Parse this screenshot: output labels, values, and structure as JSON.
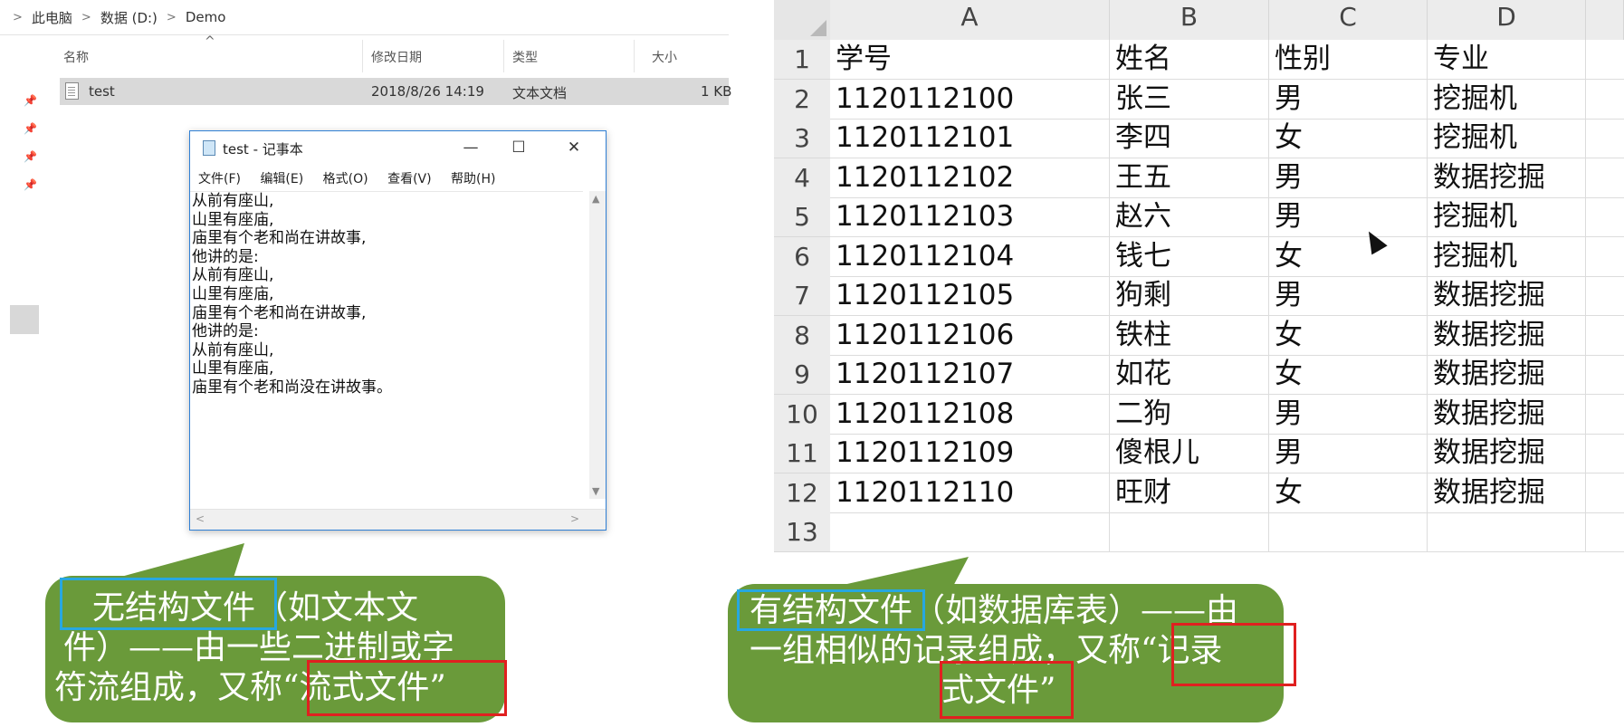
{
  "explorer": {
    "breadcrumb": [
      ">",
      "此电脑",
      ">",
      "数据 (D:)",
      ">",
      "Demo"
    ],
    "columns": {
      "name": "名称",
      "modified": "修改日期",
      "type": "类型",
      "size": "大小"
    },
    "file": {
      "name": "test",
      "modified": "2018/8/26 14:19",
      "type": "文本文档",
      "size": "1 KB"
    }
  },
  "notepad": {
    "title": "test - 记事本",
    "menu": [
      "文件(F)",
      "编辑(E)",
      "格式(O)",
      "查看(V)",
      "帮助(H)"
    ],
    "lines": [
      "从前有座山,",
      "山里有座庙,",
      "庙里有个老和尚在讲故事,",
      "他讲的是:",
      "从前有座山,",
      "山里有座庙,",
      "庙里有个老和尚在讲故事,",
      "他讲的是:",
      "从前有座山,",
      "山里有座庙,",
      "庙里有个老和尚没在讲故事。"
    ]
  },
  "sheet": {
    "columns": [
      "A",
      "B",
      "C",
      "D"
    ],
    "row_numbers": [
      "1",
      "2",
      "3",
      "4",
      "5",
      "6",
      "7",
      "8",
      "9",
      "10",
      "11",
      "12",
      "13"
    ],
    "rows": [
      [
        "学号",
        "姓名",
        "性别",
        "专业"
      ],
      [
        "1120112100",
        "张三",
        "男",
        "挖掘机"
      ],
      [
        "1120112101",
        "李四",
        "女",
        "挖掘机"
      ],
      [
        "1120112102",
        "王五",
        "男",
        "数据挖掘"
      ],
      [
        "1120112103",
        "赵六",
        "男",
        "挖掘机"
      ],
      [
        "1120112104",
        "钱七",
        "女",
        "挖掘机"
      ],
      [
        "1120112105",
        "狗剩",
        "男",
        "数据挖掘"
      ],
      [
        "1120112106",
        "铁柱",
        "女",
        "数据挖掘"
      ],
      [
        "1120112107",
        "如花",
        "女",
        "数据挖掘"
      ],
      [
        "1120112108",
        "二狗",
        "男",
        "数据挖掘"
      ],
      [
        "1120112109",
        "傻根儿",
        "男",
        "数据挖掘"
      ],
      [
        "1120112110",
        "旺财",
        "女",
        "数据挖掘"
      ],
      [
        "",
        "",
        "",
        ""
      ]
    ]
  },
  "callout_left": {
    "lines": [
      "无结构文件（如文本文",
      "件）——由一些二进制或字",
      "符流组成，又称“流式文件”"
    ],
    "highlight_blue": "无结构文件",
    "highlight_red": "“流式文件”",
    "color": "#6a9a3a"
  },
  "callout_right": {
    "lines": [
      "有结构文件（如数据库表）——由",
      "一组相似的记录组成，又称“记录",
      "式文件”"
    ],
    "highlight_blue": "有结构文件",
    "color": "#6a9a3a"
  }
}
